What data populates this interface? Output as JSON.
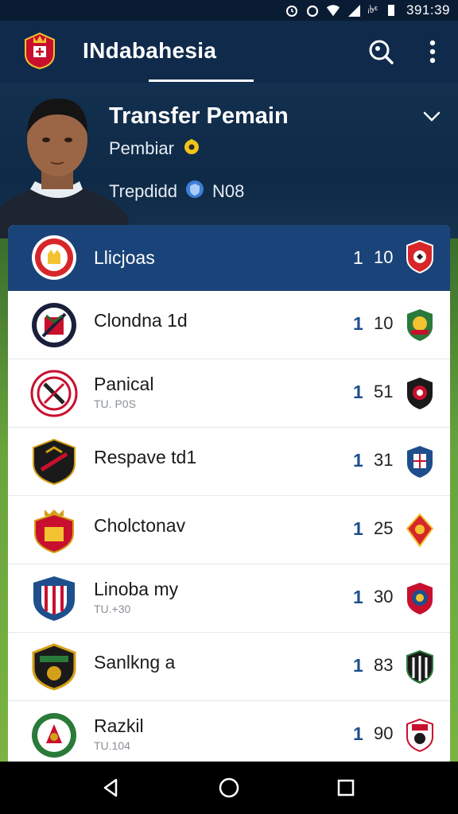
{
  "status_bar": {
    "time": "391:39",
    "signal_text": "ᵢ৳ᵋ"
  },
  "app_bar": {
    "title": "INdabahesia"
  },
  "hero": {
    "title": "Transfer Pemain",
    "subtitle": "Pembiar",
    "tag_label": "Trepdidd",
    "tag_value": "N08"
  },
  "header_row": {
    "name": "Llicjoas",
    "rank": "1",
    "score": "10"
  },
  "rows": [
    {
      "name": "Clondna 1d",
      "sub": "",
      "rank": "1",
      "score": "10"
    },
    {
      "name": "Panical",
      "sub": "TU. P0S",
      "rank": "1",
      "score": "51"
    },
    {
      "name": "Respave td1",
      "sub": "",
      "rank": "1",
      "score": "31"
    },
    {
      "name": "Cholctonav",
      "sub": "",
      "rank": "1",
      "score": "25"
    },
    {
      "name": "Linoba my",
      "sub": "TU.+30",
      "rank": "1",
      "score": "30"
    },
    {
      "name": "Sanlkng a",
      "sub": "",
      "rank": "1",
      "score": "83"
    },
    {
      "name": "Razkil",
      "sub": "TU.104",
      "rank": "1",
      "score": "90"
    }
  ],
  "colors": {
    "app_bar": "#0f2a4a",
    "header_row": "#1a4479",
    "rank_text": "#1e4f8c"
  }
}
